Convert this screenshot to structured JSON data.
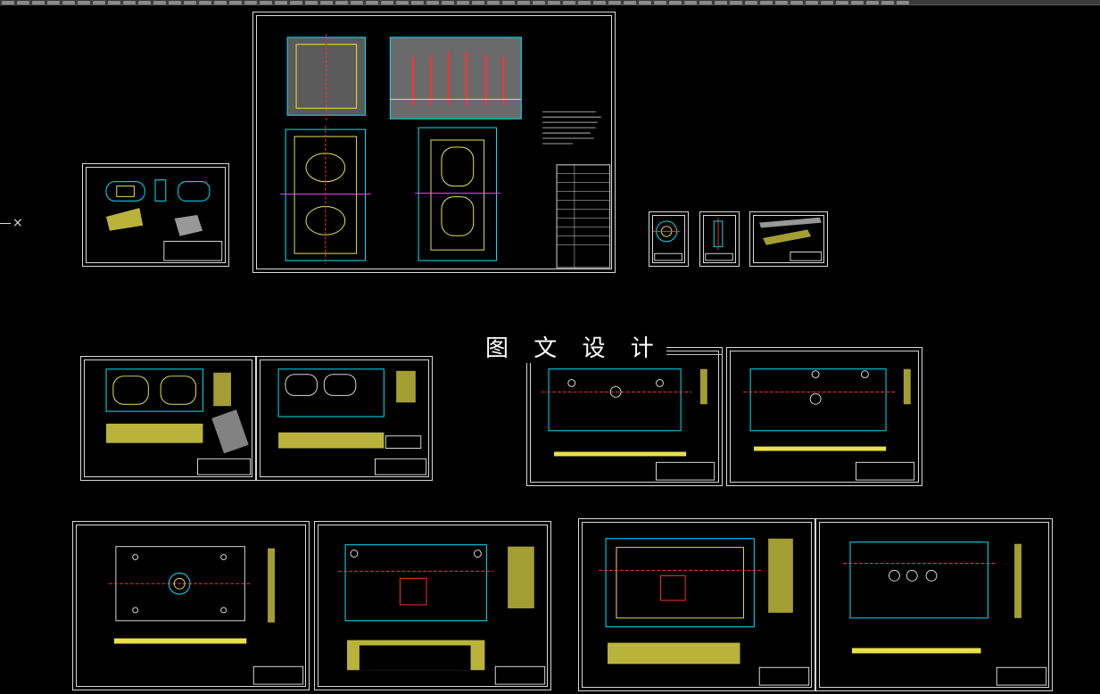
{
  "watermark": {
    "text": "图 文 设 计"
  },
  "colors": {
    "background": "#000000",
    "frame": "#d8d8d8",
    "cyan": "#00e5ff",
    "yellow": "#e8e04a",
    "red": "#ff3030",
    "green": "#40ff40",
    "magenta": "#ff40ff"
  },
  "toolbar": {
    "button_count": 60
  },
  "cursor": {
    "icon": "crosshair-icon"
  }
}
